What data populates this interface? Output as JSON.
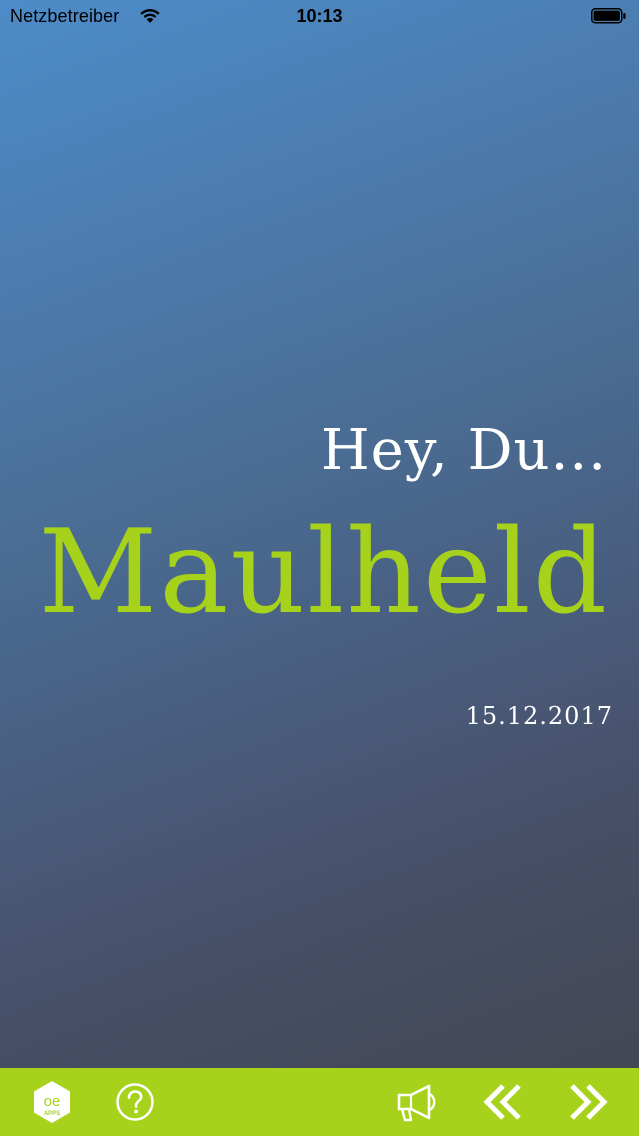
{
  "status_bar": {
    "carrier": "Netzbetreiber",
    "time": "10:13",
    "wifi_icon": "wifi-icon",
    "battery_icon": "battery-icon"
  },
  "main": {
    "greeting": "Hey, Du...",
    "app_name": "Maulheld",
    "date": "15.12.2017"
  },
  "toolbar": {
    "logo_text_top": "oe",
    "logo_text_bottom": "APPS",
    "icons": [
      "oe-apps-logo-icon",
      "help-icon",
      "megaphone-icon",
      "double-chevron-left-icon",
      "double-chevron-right-icon"
    ]
  },
  "colors": {
    "accent": "#a6d21b",
    "background_top": "#4d8cc9",
    "background_bottom": "#42464f",
    "text": "#ffffff"
  }
}
